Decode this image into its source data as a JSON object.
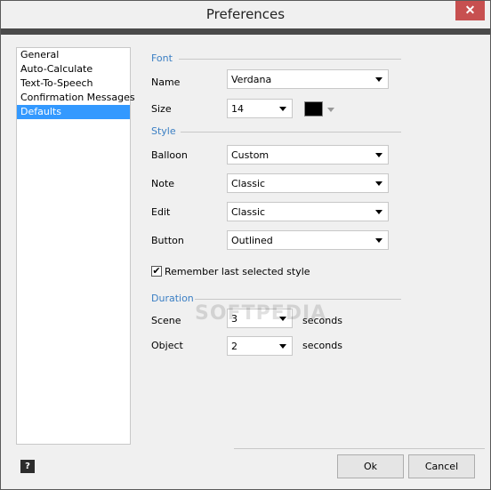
{
  "window": {
    "title": "Preferences",
    "close_glyph": "✕"
  },
  "categories": [
    {
      "label": "General",
      "selected": false
    },
    {
      "label": "Auto-Calculate",
      "selected": false
    },
    {
      "label": "Text-To-Speech",
      "selected": false
    },
    {
      "label": "Confirmation Messages",
      "selected": false
    },
    {
      "label": "Defaults",
      "selected": true
    }
  ],
  "font_section": {
    "heading": "Font",
    "name_label": "Name",
    "name_value": "Verdana",
    "size_label": "Size",
    "size_value": "14",
    "color_value": "#000000"
  },
  "style_section": {
    "heading": "Style",
    "balloon_label": "Balloon",
    "balloon_value": "Custom",
    "note_label": "Note",
    "note_value": "Classic",
    "edit_label": "Edit",
    "edit_value": "Classic",
    "button_label": "Button",
    "button_value": "Outlined",
    "remember_label": "Remember last selected style",
    "remember_checked": true,
    "check_glyph": "✔"
  },
  "duration_section": {
    "heading": "Duration",
    "scene_label": "Scene",
    "scene_value": "3",
    "object_label": "Object",
    "object_value": "2",
    "unit_label": "seconds"
  },
  "watermark": "SOFTPEDIA",
  "footer": {
    "help_label": "?",
    "ok_label": "Ok",
    "cancel_label": "Cancel"
  },
  "colors": {
    "accent": "#3b7fc4",
    "selection": "#3399ff",
    "close_button": "#c75050"
  }
}
